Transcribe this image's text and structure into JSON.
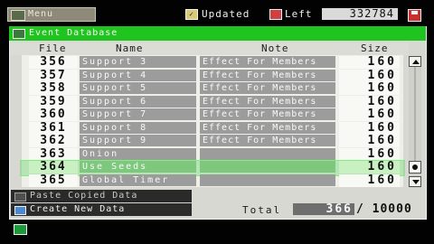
{
  "topbar": {
    "menu_label": "Menu",
    "updated_label": "Updated",
    "left_label": "Left",
    "left_value": "332784"
  },
  "panel": {
    "title": "Event Database",
    "headers": {
      "file": "File",
      "name": "Name",
      "note": "Note",
      "size": "Size"
    },
    "rows": [
      {
        "file": "356",
        "name": "Support 3",
        "note": "Effect For Members",
        "size": "160"
      },
      {
        "file": "357",
        "name": "Support 4",
        "note": "Effect For Members",
        "size": "160"
      },
      {
        "file": "358",
        "name": "Support 5",
        "note": "Effect For Members",
        "size": "160"
      },
      {
        "file": "359",
        "name": "Support 6",
        "note": "Effect For Members",
        "size": "160"
      },
      {
        "file": "360",
        "name": "Support 7",
        "note": "Effect For Members",
        "size": "160"
      },
      {
        "file": "361",
        "name": "Support 8",
        "note": "Effect For Members",
        "size": "160"
      },
      {
        "file": "362",
        "name": "Support 9",
        "note": "Effect For Members",
        "size": "160"
      },
      {
        "file": "363",
        "name": "Onion",
        "note": "",
        "size": "160"
      },
      {
        "file": "364",
        "name": "Use Seeds",
        "note": "",
        "size": "160"
      },
      {
        "file": "365",
        "name": "Global Timer",
        "note": "",
        "size": "160"
      }
    ],
    "selected_index": 8
  },
  "footer": {
    "paste_label": "Paste Copied Data",
    "create_label": "Create New Data",
    "total_label": "Total",
    "total_value": "366",
    "total_max": "/ 10000"
  },
  "colors": {
    "title_bar": "#1fc41f",
    "selection": "#50d250",
    "panel": "#d8d8d2"
  }
}
